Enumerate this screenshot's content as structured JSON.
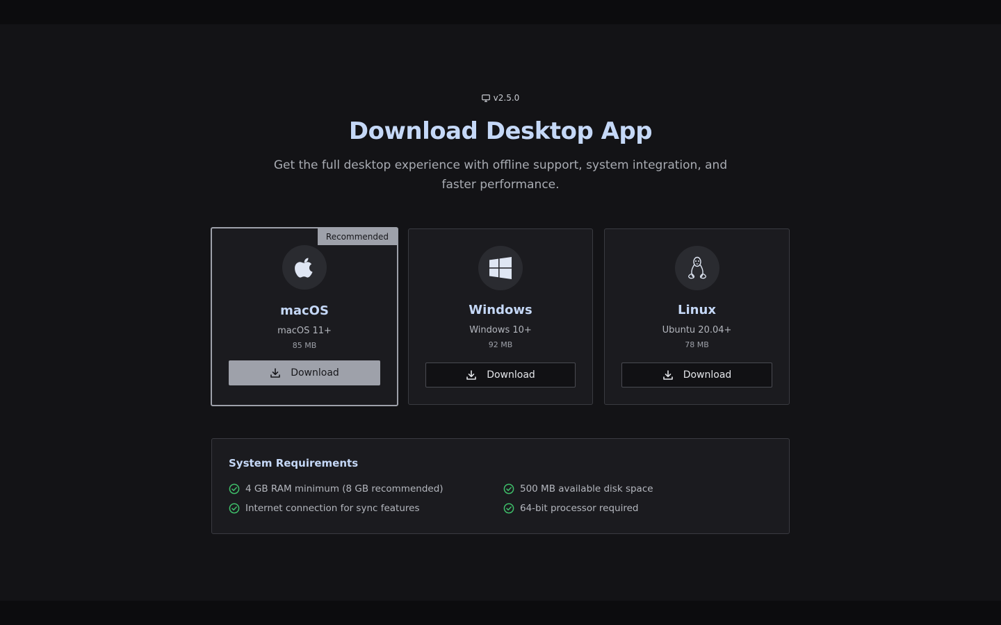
{
  "header": {
    "version": "v2.5.0",
    "title": "Download Desktop App",
    "subtitle": "Get the full desktop experience with offline support, system integration, and faster performance."
  },
  "platforms": [
    {
      "name": "macOS",
      "requirement": "macOS 11+",
      "size": "85 MB",
      "button_label": "Download",
      "badge": "Recommended",
      "icon": "apple-icon"
    },
    {
      "name": "Windows",
      "requirement": "Windows 10+",
      "size": "92 MB",
      "button_label": "Download",
      "icon": "windows-icon"
    },
    {
      "name": "Linux",
      "requirement": "Ubuntu 20.04+",
      "size": "78 MB",
      "button_label": "Download",
      "icon": "linux-icon"
    }
  ],
  "system_requirements": {
    "title": "System Requirements",
    "items": [
      "4 GB RAM minimum (8 GB recommended)",
      "500 MB available disk space",
      "Internet connection for sync features",
      "64-bit processor required"
    ]
  },
  "colors": {
    "accent_title": "#c5d8f7",
    "recommended": "#9ea1aa",
    "check": "#3fbf6a",
    "background": "#131316"
  }
}
